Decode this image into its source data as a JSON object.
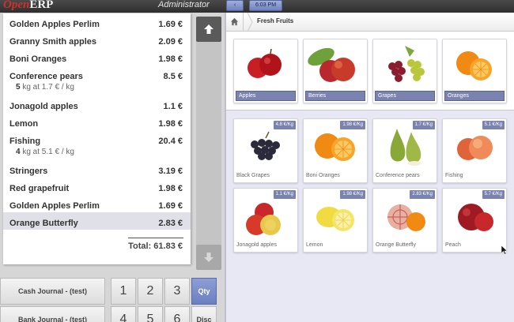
{
  "header": {
    "logo_part1": "Open",
    "logo_part2": "ERP",
    "user": "Administrator",
    "back_label": "‹",
    "clock": "6:03 PM"
  },
  "order": {
    "lines": [
      {
        "name": "Golden Apples Perlim",
        "price": "1.69 €",
        "detail_qty": "",
        "detail_text": "",
        "selected": false
      },
      {
        "name": "Granny Smith apples",
        "price": "2.09 €",
        "detail_qty": "",
        "detail_text": "",
        "selected": false
      },
      {
        "name": "Boni Oranges",
        "price": "1.98 €",
        "detail_qty": "",
        "detail_text": "",
        "selected": false
      },
      {
        "name": "Conference pears",
        "price": "8.5 €",
        "detail_qty": "5",
        "detail_text": "kg at 1.7 € / kg",
        "selected": false
      },
      {
        "name": "Jonagold apples",
        "price": "1.1 €",
        "detail_qty": "",
        "detail_text": "",
        "selected": false
      },
      {
        "name": "Lemon",
        "price": "1.98 €",
        "detail_qty": "",
        "detail_text": "",
        "selected": false
      },
      {
        "name": "Fishing",
        "price": "20.4 €",
        "detail_qty": "4",
        "detail_text": "kg at 5.1 € / kg",
        "selected": false
      },
      {
        "name": "Stringers",
        "price": "3.19 €",
        "detail_qty": "",
        "detail_text": "",
        "selected": false
      },
      {
        "name": "Red grapefruit",
        "price": "1.98 €",
        "detail_qty": "",
        "detail_text": "",
        "selected": false
      },
      {
        "name": "Golden Apples Perlim",
        "price": "1.69 €",
        "detail_qty": "",
        "detail_text": "",
        "selected": false
      },
      {
        "name": "Orange Butterfly",
        "price": "2.83 €",
        "detail_qty": "",
        "detail_text": "",
        "selected": true
      }
    ],
    "total": "Total: 61.83 €"
  },
  "controls": {
    "journals": [
      "Cash Journal - (test)",
      "Bank Journal - (test)"
    ],
    "keys_row1": [
      "1",
      "2",
      "3"
    ],
    "keys_row2": [
      "4",
      "5",
      "6"
    ],
    "mode_qty": "Qty",
    "mode_disc": "Disc"
  },
  "breadcrumb": {
    "current": "Fresh Fruits"
  },
  "categories": [
    {
      "label": "Apples",
      "icon": "apples-image"
    },
    {
      "label": "Berries",
      "icon": "berries-image"
    },
    {
      "label": "Grapes",
      "icon": "grapes-image"
    },
    {
      "label": "Oranges",
      "icon": "oranges-image"
    }
  ],
  "products": [
    {
      "name": "Black Grapes",
      "price": "4.8 €/Kg",
      "icon": "black-grapes-image"
    },
    {
      "name": "Boni Oranges",
      "price": "1.98 €/Kg",
      "icon": "oranges-image"
    },
    {
      "name": "Conference pears",
      "price": "1.7 €/Kg",
      "icon": "pears-image"
    },
    {
      "name": "Fishing",
      "price": "5.1 €/Kg",
      "icon": "peaches-image"
    },
    {
      "name": "Jonagold apples",
      "price": "1.1 €/Kg",
      "icon": "apples-image"
    },
    {
      "name": "Lemon",
      "price": "1.98 €/Kg",
      "icon": "lemon-image"
    },
    {
      "name": "Orange Butterfly",
      "price": "2.83 €/Kg",
      "icon": "blood-orange-image"
    },
    {
      "name": "Peach",
      "price": "5.7 €/Kg",
      "icon": "peach-image"
    }
  ],
  "colors": {
    "accent": "#7a82b0",
    "logo_red": "#d0302a",
    "active_key": "#6b7fc0"
  }
}
